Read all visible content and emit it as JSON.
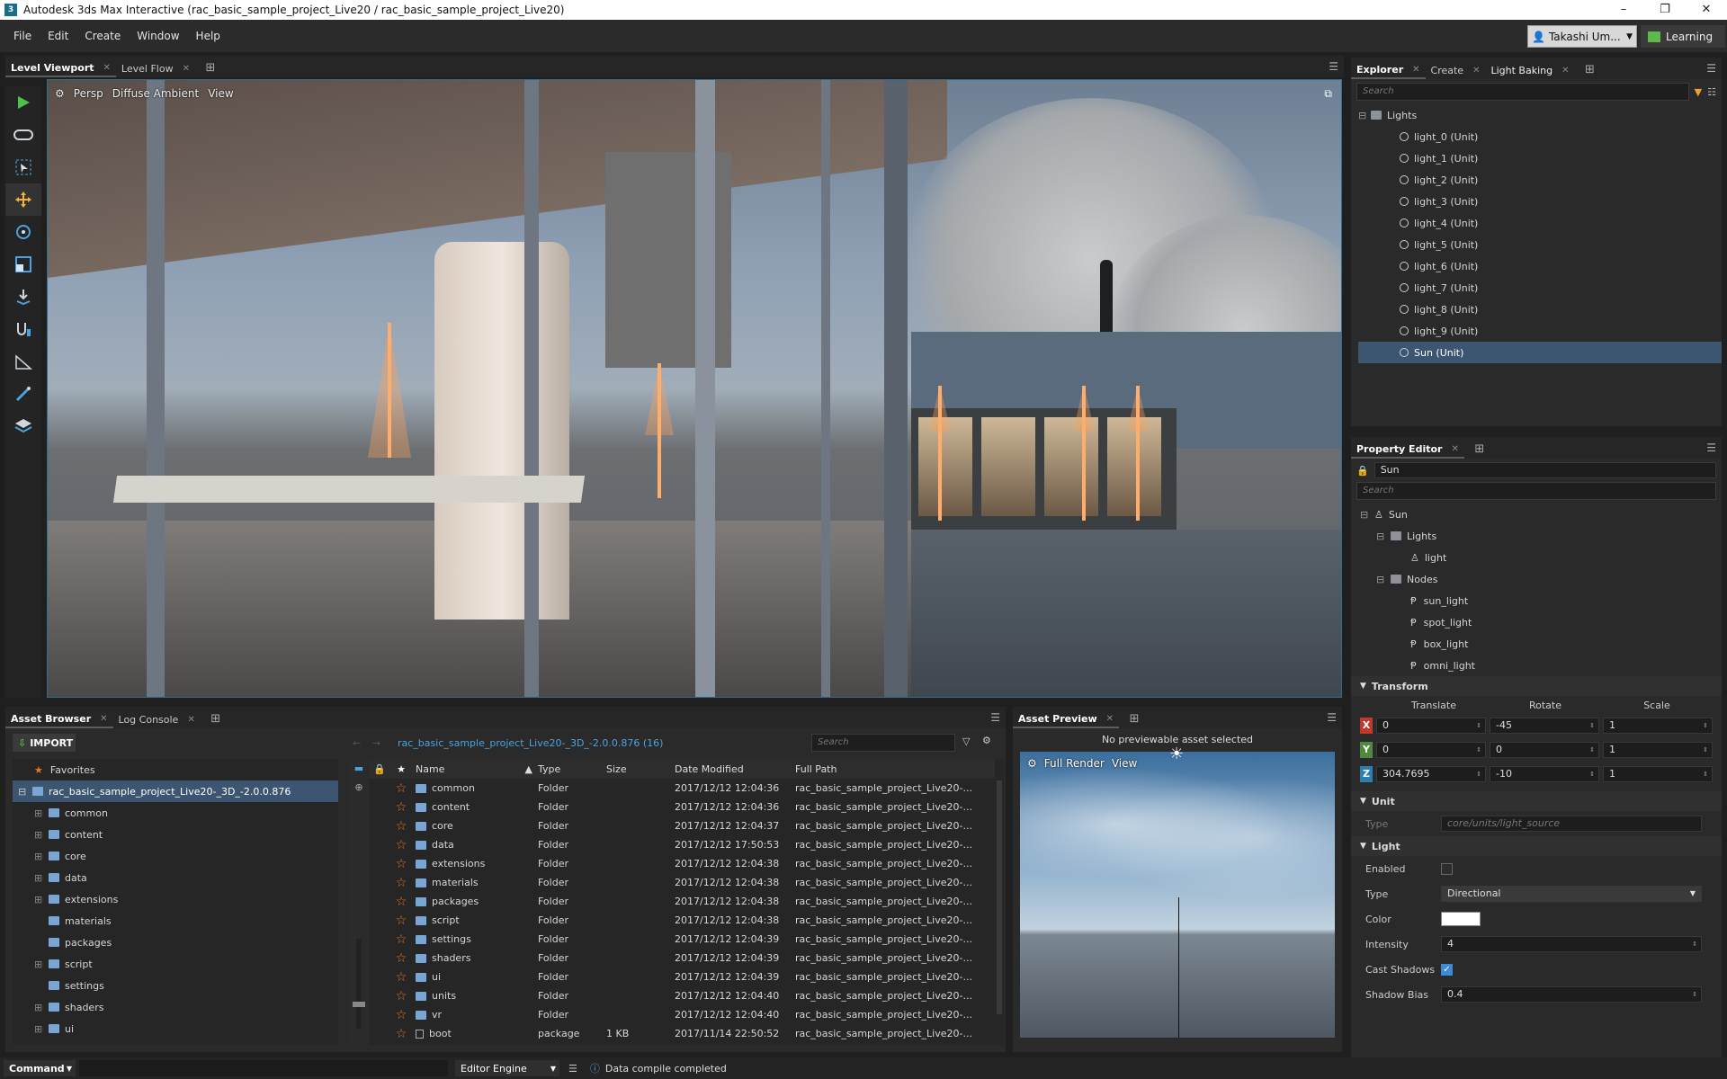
{
  "window": {
    "title": "Autodesk 3ds Max Interactive (rac_basic_sample_project_Live20 / rac_basic_sample_project_Live20)",
    "minimize": "–",
    "restore": "❐",
    "close": "✕"
  },
  "menu": [
    "File",
    "Edit",
    "Create",
    "Window",
    "Help"
  ],
  "account": {
    "user": "Takashi Um...",
    "learning": "Learning"
  },
  "viewport_tabs": [
    {
      "label": "Level Viewport",
      "active": true
    },
    {
      "label": "Level Flow",
      "active": false
    }
  ],
  "viewport": {
    "camera": "Persp",
    "shading": "Diffuse Ambient",
    "view": "View"
  },
  "toolbar_icons": [
    "play-icon",
    "gamepad-icon",
    "select-icon",
    "move-icon",
    "rotate-icon",
    "scale-icon",
    "place-icon",
    "snap-icon",
    "ruler-icon",
    "paint-icon",
    "layers-icon"
  ],
  "explorer": {
    "tabs": [
      {
        "label": "Explorer",
        "active": true
      },
      {
        "label": "Create",
        "active": false
      },
      {
        "label": "Light Baking",
        "active": false
      }
    ],
    "search_placeholder": "Search",
    "root": "Lights",
    "items": [
      "light_0 (Unit)",
      "light_1 (Unit)",
      "light_2 (Unit)",
      "light_3 (Unit)",
      "light_4 (Unit)",
      "light_5 (Unit)",
      "light_6 (Unit)",
      "light_7 (Unit)",
      "light_8 (Unit)",
      "light_9 (Unit)",
      "Sun (Unit)"
    ],
    "selected": "Sun (Unit)"
  },
  "property_editor": {
    "tab": "Property Editor",
    "name": "Sun",
    "search_placeholder": "Search",
    "tree": {
      "root": "Sun",
      "lights_folder": "Lights",
      "light": "light",
      "nodes_folder": "Nodes",
      "nodes": [
        "sun_light",
        "spot_light",
        "box_light",
        "omni_light"
      ]
    },
    "transform": {
      "header": "Transform",
      "translate": "Translate",
      "rotate": "Rotate",
      "scale": "Scale",
      "rows": [
        {
          "axis": "X",
          "color": "#c0392b",
          "t": "0",
          "r": "-45",
          "s": "1"
        },
        {
          "axis": "Y",
          "color": "#4f8a3c",
          "t": "0",
          "r": "0",
          "s": "1"
        },
        {
          "axis": "Z",
          "color": "#2e7fb0",
          "t": "304.7695",
          "r": "-10",
          "s": "1"
        }
      ]
    },
    "unit": {
      "header": "Unit",
      "type_label": "Type",
      "type_value": "core/units/light_source"
    },
    "light": {
      "header": "Light",
      "enabled_label": "Enabled",
      "enabled": false,
      "type_label": "Type",
      "type_value": "Directional",
      "color_label": "Color",
      "color": "#ffffff",
      "intensity_label": "Intensity",
      "intensity": "4",
      "cast_label": "Cast Shadows",
      "cast": true,
      "bias_label": "Shadow Bias",
      "bias": "0.4"
    }
  },
  "asset_browser": {
    "tabs": [
      {
        "label": "Asset Browser",
        "active": true
      },
      {
        "label": "Log Console",
        "active": false
      }
    ],
    "import": "IMPORT",
    "path": "rac_basic_sample_project_Live20-_3D_-2.0.0.876 (16)",
    "search_placeholder": "Search",
    "favorites": "Favorites",
    "project": "rac_basic_sample_project_Live20-_3D_-2.0.0.876",
    "folders": [
      "common",
      "content",
      "core",
      "data",
      "extensions",
      "materials",
      "packages",
      "script",
      "settings",
      "shaders",
      "ui"
    ],
    "columns": {
      "name": "Name",
      "type": "Type",
      "size": "Size",
      "date": "Date Modified",
      "path": "Full Path"
    },
    "rows": [
      {
        "name": "common",
        "type": "Folder",
        "size": "",
        "date": "2017/12/12 12:04:36",
        "path": "rac_basic_sample_project_Live20-..."
      },
      {
        "name": "content",
        "type": "Folder",
        "size": "",
        "date": "2017/12/12 12:04:36",
        "path": "rac_basic_sample_project_Live20-..."
      },
      {
        "name": "core",
        "type": "Folder",
        "size": "",
        "date": "2017/12/12 12:04:37",
        "path": "rac_basic_sample_project_Live20-..."
      },
      {
        "name": "data",
        "type": "Folder",
        "size": "",
        "date": "2017/12/12 17:50:53",
        "path": "rac_basic_sample_project_Live20-..."
      },
      {
        "name": "extensions",
        "type": "Folder",
        "size": "",
        "date": "2017/12/12 12:04:38",
        "path": "rac_basic_sample_project_Live20-..."
      },
      {
        "name": "materials",
        "type": "Folder",
        "size": "",
        "date": "2017/12/12 12:04:38",
        "path": "rac_basic_sample_project_Live20-..."
      },
      {
        "name": "packages",
        "type": "Folder",
        "size": "",
        "date": "2017/12/12 12:04:38",
        "path": "rac_basic_sample_project_Live20-..."
      },
      {
        "name": "script",
        "type": "Folder",
        "size": "",
        "date": "2017/12/12 12:04:38",
        "path": "rac_basic_sample_project_Live20-..."
      },
      {
        "name": "settings",
        "type": "Folder",
        "size": "",
        "date": "2017/12/12 12:04:39",
        "path": "rac_basic_sample_project_Live20-..."
      },
      {
        "name": "shaders",
        "type": "Folder",
        "size": "",
        "date": "2017/12/12 12:04:39",
        "path": "rac_basic_sample_project_Live20-..."
      },
      {
        "name": "ui",
        "type": "Folder",
        "size": "",
        "date": "2017/12/12 12:04:39",
        "path": "rac_basic_sample_project_Live20-..."
      },
      {
        "name": "units",
        "type": "Folder",
        "size": "",
        "date": "2017/12/12 12:04:40",
        "path": "rac_basic_sample_project_Live20-..."
      },
      {
        "name": "vr",
        "type": "Folder",
        "size": "",
        "date": "2017/12/12 12:04:40",
        "path": "rac_basic_sample_project_Live20-..."
      },
      {
        "name": "boot",
        "type": "package",
        "size": "1 KB",
        "date": "2017/11/14 22:50:52",
        "path": "rac_basic_sample_project_Live20-..."
      }
    ]
  },
  "asset_preview": {
    "tab": "Asset Preview",
    "message": "No previewable asset selected",
    "render": "Full Render",
    "view": "View"
  },
  "status": {
    "command": "Command",
    "engine": "Editor Engine",
    "message": "Data compile completed"
  }
}
